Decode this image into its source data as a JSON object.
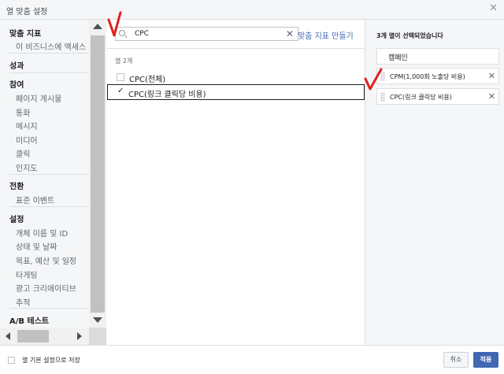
{
  "header": {
    "title": "열 맞춤 설정",
    "close_icon": "close-icon"
  },
  "sidebar": {
    "sections": [
      {
        "title": "맞춤 지표",
        "items": [
          "이 비즈니스에 액세스"
        ]
      },
      {
        "title": "성과",
        "items": []
      },
      {
        "title": "참여",
        "items": [
          "페이지 게시물",
          "통화",
          "메시지",
          "미디어",
          "클릭",
          "인지도"
        ]
      },
      {
        "title": "전환",
        "items": [
          "표준 이벤트"
        ]
      },
      {
        "title": "설정",
        "items": [
          "개체 이름 및 ID",
          "상태 및 날짜",
          "목표, 예산 및 일정",
          "타게팅",
          "광고 크리에이티브",
          "추적"
        ]
      },
      {
        "title": "A/B 테스트",
        "items": []
      }
    ]
  },
  "search": {
    "value": "CPC",
    "clear_icon": "close-icon"
  },
  "create_metric_link": "맞춤 지표 만들기",
  "results": {
    "count_label": "열 2개",
    "items": [
      {
        "label": "CPC(전체)",
        "checked": false
      },
      {
        "label": "CPC(링크 클릭당 비용)",
        "checked": true
      }
    ]
  },
  "selected_panel": {
    "header": "3개 열이 선택되었습니다",
    "fixed": "캠페인",
    "chips": [
      {
        "label": "CPM(1,000회 노출당 비용)"
      },
      {
        "label": "CPC(링크 클릭당 비용)"
      }
    ]
  },
  "footer": {
    "save_default_label": "열 기본 설정으로 저장",
    "cancel_label": "취소",
    "apply_label": "적용"
  },
  "colors": {
    "accent": "#4267b2",
    "annotation": "#e02020"
  }
}
